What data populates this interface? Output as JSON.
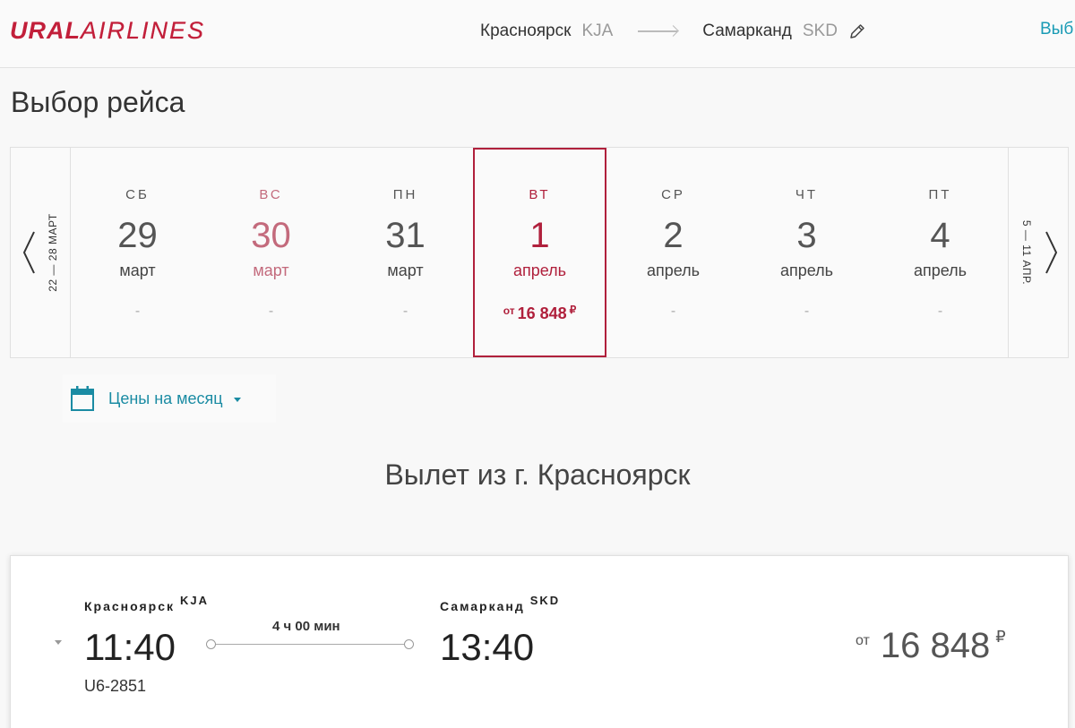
{
  "brand": {
    "part1": "URAL",
    "part2": "AIRLINES",
    "color": "#c21f3a"
  },
  "header": {
    "origin_city": "Красноярск",
    "origin_code": "KJA",
    "dest_city": "Самарканд",
    "dest_code": "SKD",
    "right_link": "Выб"
  },
  "page_title": "Выбор рейса",
  "date_strip": {
    "prev_week": "22 — 28 МАРТ",
    "next_week": "5 — 11 АПР.",
    "days": [
      {
        "dow": "СБ",
        "num": "29",
        "month": "март",
        "price": "-"
      },
      {
        "dow": "ВС",
        "num": "30",
        "month": "март",
        "price": "-"
      },
      {
        "dow": "ПН",
        "num": "31",
        "month": "март",
        "price": "-"
      },
      {
        "dow": "ВТ",
        "num": "1",
        "month": "апрель",
        "price_from": "от",
        "price": "16 848",
        "currency": "₽"
      },
      {
        "dow": "СР",
        "num": "2",
        "month": "апрель",
        "price": "-"
      },
      {
        "dow": "ЧТ",
        "num": "3",
        "month": "апрель",
        "price": "-"
      },
      {
        "dow": "ПТ",
        "num": "4",
        "month": "апрель",
        "price": "-"
      }
    ],
    "selected_color": "#b0203c"
  },
  "month_prices": {
    "label": "Цены на месяц",
    "icon": "calendar-icon",
    "color": "#1a8ba3"
  },
  "departure_heading": "Вылет из г. Красноярск",
  "flight": {
    "from_city": "Красноярск",
    "from_code": "KJA",
    "to_city": "Самарканд",
    "to_code": "SKD",
    "dep_time": "11:40",
    "arr_time": "13:40",
    "duration": "4 ч 00 мин",
    "flight_no": "U6-2851",
    "price_from": "от",
    "price": "16 848",
    "currency": "₽"
  }
}
